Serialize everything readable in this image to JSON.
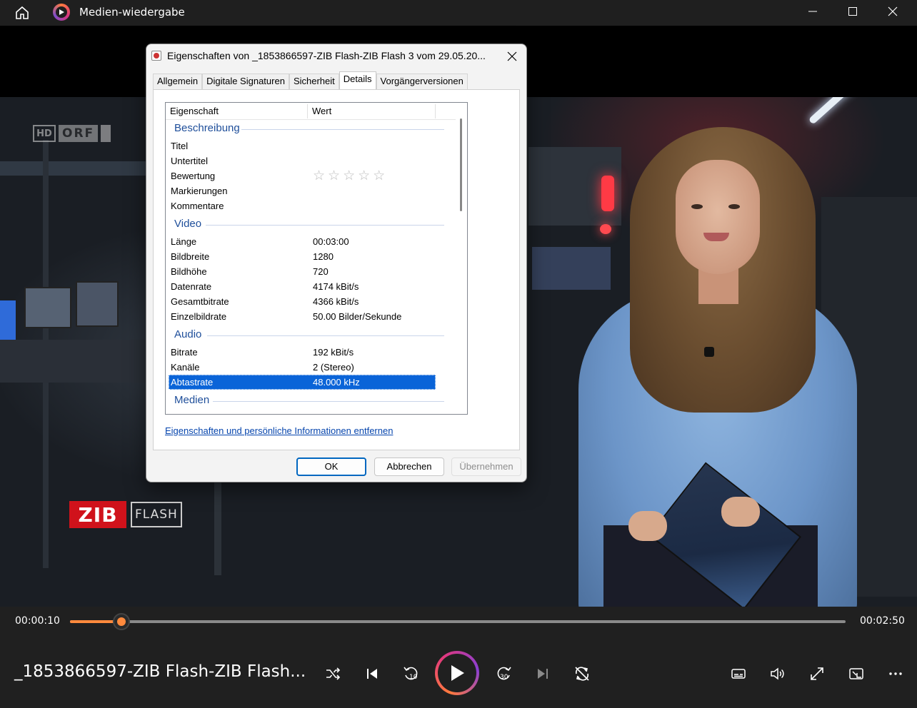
{
  "app": {
    "title": "Medien-wiedergabe"
  },
  "player": {
    "current_time": "00:00:10",
    "total_time": "00:02:50",
    "progress": 0.066,
    "media_title": "_1853866597-ZIB Flash-ZIB Flash...",
    "accent_color": "#ff8a3d"
  },
  "video_logos": {
    "orf_hd": "HD",
    "orf_word": "ORF",
    "zib": "ZIB",
    "flash": "FLASH"
  },
  "dialog": {
    "title": "Eigenschaften von _1853866597-ZIB Flash-ZIB Flash 3 vom 29.05.20...",
    "tabs": [
      {
        "label": "Allgemein",
        "active": false
      },
      {
        "label": "Digitale Signaturen",
        "active": false
      },
      {
        "label": "Sicherheit",
        "active": false
      },
      {
        "label": "Details",
        "active": true
      },
      {
        "label": "Vorgängerversionen",
        "active": false
      }
    ],
    "columns": {
      "property": "Eigenschaft",
      "value": "Wert"
    },
    "groups": {
      "beschreibung": {
        "label": "Beschreibung",
        "rows": [
          {
            "k": "Titel",
            "v": ""
          },
          {
            "k": "Untertitel",
            "v": ""
          },
          {
            "k": "Bewertung",
            "v": ""
          },
          {
            "k": "Markierungen",
            "v": ""
          },
          {
            "k": "Kommentare",
            "v": ""
          }
        ]
      },
      "video": {
        "label": "Video",
        "rows": [
          {
            "k": "Länge",
            "v": "00:03:00"
          },
          {
            "k": "Bildbreite",
            "v": "1280"
          },
          {
            "k": "Bildhöhe",
            "v": "720"
          },
          {
            "k": "Datenrate",
            "v": "4174 kBit/s"
          },
          {
            "k": "Gesamtbitrate",
            "v": "4366 kBit/s"
          },
          {
            "k": "Einzelbildrate",
            "v": "50.00 Bilder/Sekunde"
          }
        ]
      },
      "audio": {
        "label": "Audio",
        "rows": [
          {
            "k": "Bitrate",
            "v": "192 kBit/s"
          },
          {
            "k": "Kanäle",
            "v": "2 (Stereo)"
          },
          {
            "k": "Abtastrate",
            "v": "48.000 kHz",
            "selected": true
          }
        ]
      },
      "medien": {
        "label": "Medien"
      }
    },
    "rating_stars": "☆☆☆☆☆",
    "rating_value": 0,
    "link": "Eigenschaften und persönliche Informationen entfernen",
    "buttons": {
      "ok": "OK",
      "cancel": "Abbrechen",
      "apply": "Übernehmen"
    }
  }
}
